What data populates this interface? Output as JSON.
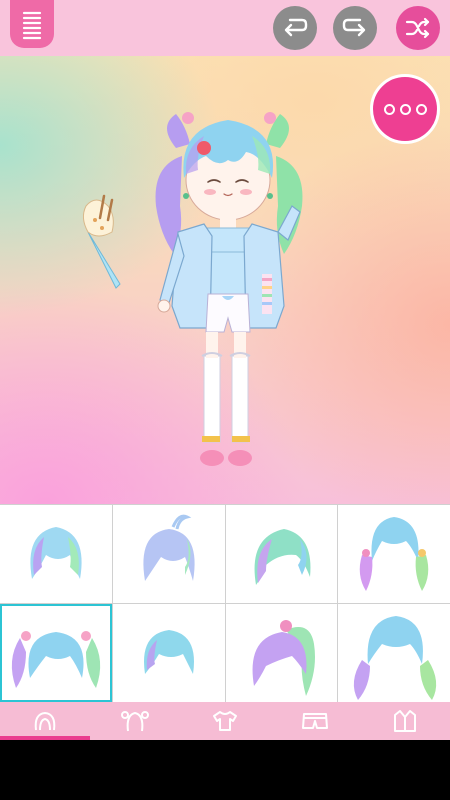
{
  "toolbar": {
    "menu_icon": "list-menu-icon",
    "undo_icon": "undo-icon",
    "redo_icon": "redo-icon",
    "shuffle_icon": "shuffle-icon"
  },
  "more_button": {
    "icon": "more-dots-icon"
  },
  "colors": {
    "topbar": "#f9c4dc",
    "accent": "#ee3f92",
    "toolbar_grey": "#8c8c8c",
    "tabbar": "#f6bcd4",
    "selection": "#2cc4d4"
  },
  "hair_options": [
    {
      "style": "short-bob-bangs",
      "selected": false
    },
    {
      "style": "short-bob-ahoge",
      "selected": false
    },
    {
      "style": "side-swept-medium",
      "selected": false
    },
    {
      "style": "low-pigtails-ribbons",
      "selected": false
    },
    {
      "style": "twin-tails-bows",
      "selected": true
    },
    {
      "style": "pixie-crop",
      "selected": false
    },
    {
      "style": "high-ponytail-bow",
      "selected": false
    },
    {
      "style": "long-wavy-pigtails",
      "selected": false
    }
  ],
  "category_tabs": [
    {
      "icon": "face-hair-icon",
      "active": true
    },
    {
      "icon": "hairstyle-icon",
      "active": false
    },
    {
      "icon": "shirt-icon",
      "active": false
    },
    {
      "icon": "shorts-icon",
      "active": false
    },
    {
      "icon": "jacket-icon",
      "active": false
    }
  ]
}
